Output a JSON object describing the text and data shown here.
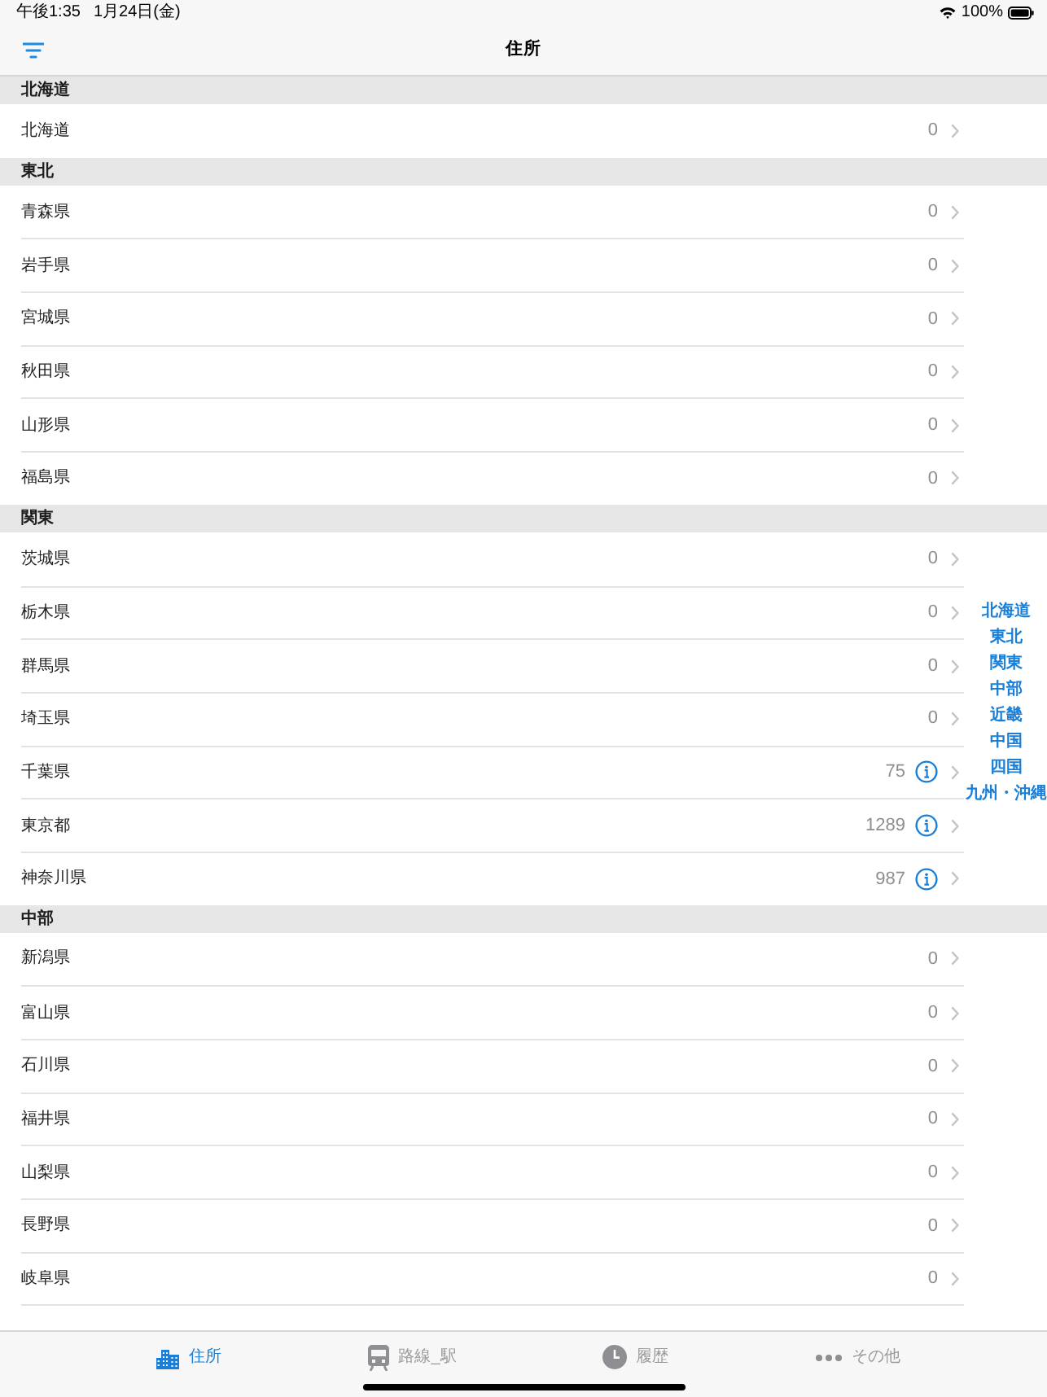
{
  "status_bar": {
    "time": "午後1:35",
    "date": "1月24日(金)",
    "battery": "100%"
  },
  "nav_bar": {
    "title": "住所"
  },
  "sections": [
    {
      "title": "北海道",
      "rows": [
        {
          "name": "北海道",
          "count": "0",
          "info": false
        }
      ]
    },
    {
      "title": "東北",
      "rows": [
        {
          "name": "青森県",
          "count": "0",
          "info": false
        },
        {
          "name": "岩手県",
          "count": "0",
          "info": false
        },
        {
          "name": "宮城県",
          "count": "0",
          "info": false
        },
        {
          "name": "秋田県",
          "count": "0",
          "info": false
        },
        {
          "name": "山形県",
          "count": "0",
          "info": false
        },
        {
          "name": "福島県",
          "count": "0",
          "info": false
        }
      ]
    },
    {
      "title": "関東",
      "rows": [
        {
          "name": "茨城県",
          "count": "0",
          "info": false
        },
        {
          "name": "栃木県",
          "count": "0",
          "info": false
        },
        {
          "name": "群馬県",
          "count": "0",
          "info": false
        },
        {
          "name": "埼玉県",
          "count": "0",
          "info": false
        },
        {
          "name": "千葉県",
          "count": "75",
          "info": true
        },
        {
          "name": "東京都",
          "count": "1289",
          "info": true
        },
        {
          "name": "神奈川県",
          "count": "987",
          "info": true
        }
      ]
    },
    {
      "title": "中部",
      "rows": [
        {
          "name": "新潟県",
          "count": "0",
          "info": false
        },
        {
          "name": "富山県",
          "count": "0",
          "info": false
        },
        {
          "name": "石川県",
          "count": "0",
          "info": false
        },
        {
          "name": "福井県",
          "count": "0",
          "info": false
        },
        {
          "name": "山梨県",
          "count": "0",
          "info": false
        },
        {
          "name": "長野県",
          "count": "0",
          "info": false
        },
        {
          "name": "岐阜県",
          "count": "0",
          "info": false
        }
      ]
    }
  ],
  "section_index": [
    "北海道",
    "東北",
    "関東",
    "中部",
    "近畿",
    "中国",
    "四国",
    "九州・沖縄"
  ],
  "tab_bar": [
    {
      "label": "住所",
      "kind": "buildings",
      "selected": true
    },
    {
      "label": "路線_駅",
      "kind": "train",
      "selected": false
    },
    {
      "label": "履歴",
      "kind": "clock",
      "selected": false
    },
    {
      "label": "その他",
      "kind": "more",
      "selected": false
    }
  ]
}
